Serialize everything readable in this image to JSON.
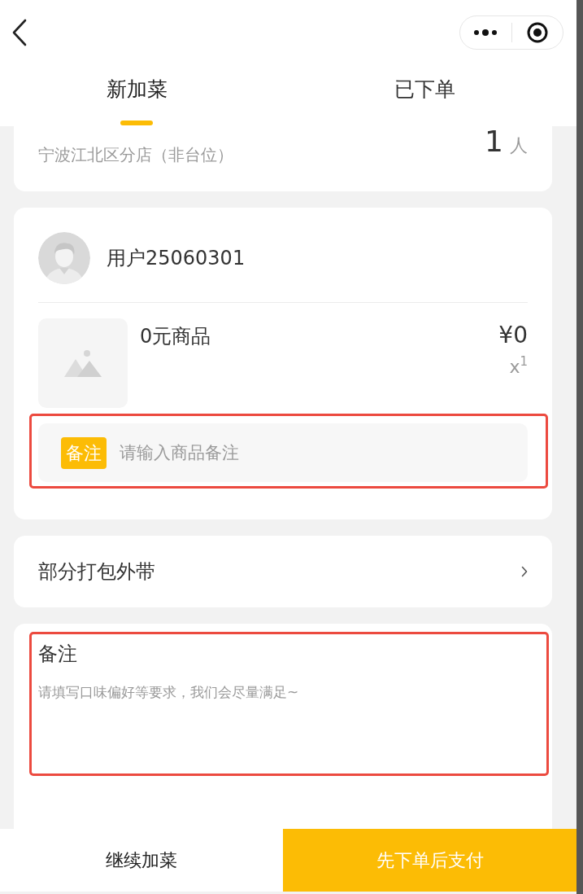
{
  "tabs": [
    {
      "label": "新加菜",
      "selected": true
    },
    {
      "label": "已下单",
      "selected": false
    }
  ],
  "store": {
    "name": "宁波江北区分店（非台位）",
    "guest_count": "1",
    "guest_unit": "人"
  },
  "order": {
    "user_name": "用户25060301",
    "items": [
      {
        "name": "0元商品",
        "price": "¥0",
        "quantity": "x$^{1}$",
        "note": {
          "tag": "备注",
          "placeholder": "请输入商品备注",
          "highlighted": true
        }
      }
    ]
  },
  "packaging": {
    "label": "部分打包外带"
  },
  "remark": {
    "title": "备注",
    "placeholder": "请填写口味偏好等要求，我们会尽量满足~",
    "highlighted": true
  },
  "bottom_bar": {
    "buttons": [
      {
        "label": "继续加菜",
        "kind": "secondary"
      },
      {
        "label": "先下单后支付",
        "kind": "primary"
      }
    ]
  }
}
